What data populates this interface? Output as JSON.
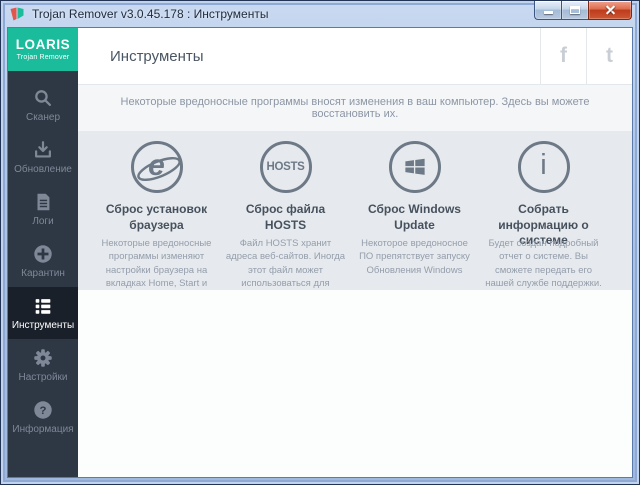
{
  "window": {
    "title": "Trojan Remover v3.0.45.178 : Инструменты"
  },
  "sidebar": {
    "logo": {
      "brand": "LOARIS",
      "subtitle": "Trojan Remover"
    },
    "items": [
      {
        "label": "Сканер",
        "icon": "search-icon",
        "selected": false
      },
      {
        "label": "Обновление",
        "icon": "download-icon",
        "selected": false
      },
      {
        "label": "Логи",
        "icon": "document-icon",
        "selected": false
      },
      {
        "label": "Карантин",
        "icon": "plus-circle-icon",
        "selected": false
      },
      {
        "label": "Инструменты",
        "icon": "list-icon",
        "selected": true
      },
      {
        "label": "Настройки",
        "icon": "gear-icon",
        "selected": false
      },
      {
        "label": "Информация",
        "icon": "question-circle-icon",
        "selected": false
      }
    ]
  },
  "header": {
    "title": "Инструменты",
    "facebook_glyph": "f",
    "twitter_glyph": "t"
  },
  "banner": {
    "text": "Некоторые вредоносные программы вносят изменения в ваш компьютер. Здесь вы можете восстановить их."
  },
  "tools": [
    {
      "icon": "ie-browser-icon",
      "icon_text": "e",
      "title": "Сброс установок браузера",
      "description": "Некоторые вредоносные программы изменяют настройки браузера на вкладках Home, Start и Search, чтобы перенаправлять браузер на другие веб-сайты"
    },
    {
      "icon": "hosts-icon",
      "icon_text": "HOSTS",
      "title": "Сброс файла HOSTS",
      "description": "Файл HOSTS хранит адреса веб-сайтов. Иногда этот файл может использоваться для ускорения доступа к сайтам, которые вы часто посещаете"
    },
    {
      "icon": "windows-icon",
      "icon_text": "",
      "title": "Сброс Windows Update",
      "description": "Некоторое вредоносное ПО препятствует запуску Обновления Windows"
    },
    {
      "icon": "info-icon",
      "icon_text": "i",
      "title": "Собрать информацию о системе",
      "description": "Будет создан подробный отчет о системе. Вы сможете передать его нашей службе поддержки."
    }
  ],
  "colors": {
    "accent": "#1abc9c",
    "sidebar_bg": "#2e3744",
    "sidebar_active_bg": "#1a202a",
    "sidebar_text": "#7e8897",
    "icon_gray": "#6e7987",
    "card_bg": "#e6eaee",
    "banner_bg": "#f5f6f8",
    "title_text": "#47515d",
    "desc_text": "#949dab",
    "banner_text": "#8c96a4",
    "social_gray": "#c9ced5",
    "titlebar_blue": "#b2c7e6",
    "close_red": "#c8492b"
  }
}
